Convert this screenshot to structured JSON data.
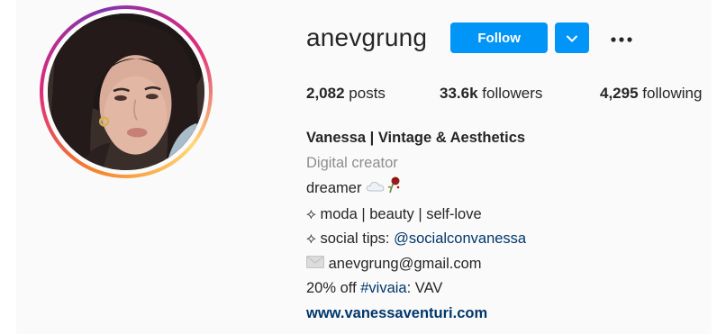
{
  "profile": {
    "username": "anevgrung",
    "follow_label": "Follow",
    "more_icon": "more-horizontal-icon",
    "dropdown_icon": "chevron-down-icon"
  },
  "stats": {
    "posts_count": "2,082",
    "posts_label": "posts",
    "followers_count": "33.6k",
    "followers_label": "followers",
    "following_count": "4,295",
    "following_label": "following"
  },
  "bio": {
    "name": "Vanessa | Vintage & Aesthetics",
    "category": "Digital creator",
    "line1_text": "dreamer",
    "line2_text": "⟡ moda | beauty | self-love",
    "line3_prefix": "⟡ social tips: ",
    "line3_mention": "@socialconvanessa",
    "email": "anevgrung@gmail.com",
    "line5_prefix": "20% off ",
    "line5_hashtag": "#vivaia",
    "line5_suffix": ": VAV",
    "website": "www.vanessaventuri.com"
  },
  "colors": {
    "follow_blue": "#0095f6",
    "link_blue": "#00376b",
    "text": "#262626",
    "muted": "#8e8e8e"
  }
}
